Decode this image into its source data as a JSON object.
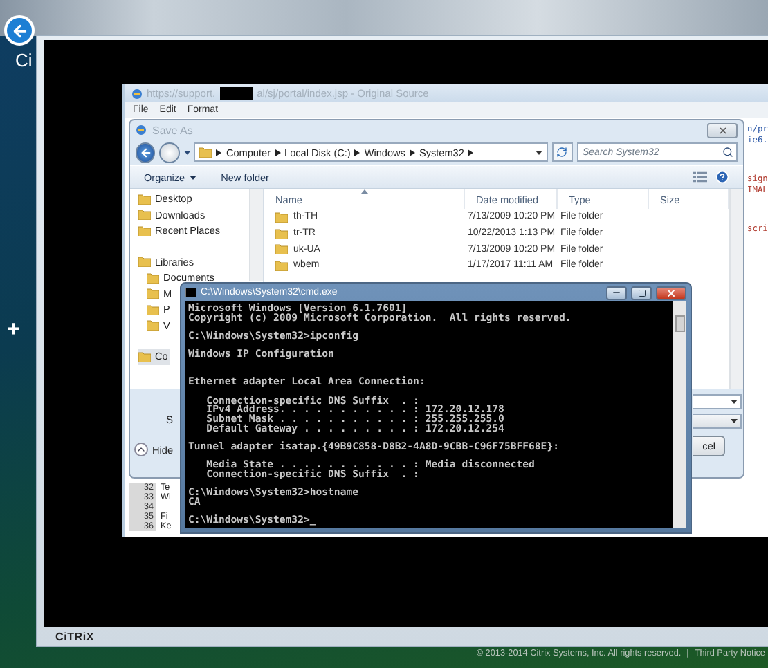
{
  "desktop": {
    "side_label": "Ci",
    "add_button": "+"
  },
  "source_window": {
    "title_start": "https://support.",
    "title_end": "al/sj/portal/index.jsp - Original Source",
    "menu": [
      "File",
      "Edit",
      "Format"
    ],
    "code_blocks": [
      [
        {
          "text": "n/pr",
          "color": "#2e5aa8"
        },
        {
          "text": "ie6.",
          "color": "#2e5aa8"
        }
      ],
      [
        {
          "text": "sign",
          "color": "#b03a2e"
        },
        {
          "text": "IMAL",
          "color": "#b03a2e"
        }
      ],
      [
        {
          "text": "scri",
          "color": "#b03a2e"
        }
      ]
    ],
    "gutter_lines": [
      {
        "number": "32",
        "text": "Te"
      },
      {
        "number": "33",
        "text": "Wi"
      },
      {
        "number": "34"
      },
      {
        "number": "35",
        "text": "Fi"
      },
      {
        "number": "36",
        "text": "Ke"
      }
    ]
  },
  "save_dialog": {
    "title": "Save As",
    "path": [
      "Computer",
      "Local Disk (C:)",
      "Windows",
      "System32"
    ],
    "search": {
      "placeholder": "Search System32"
    },
    "toolbar": [
      {
        "label": "Organize",
        "menu": true
      },
      {
        "label": "New folder",
        "menu": false
      }
    ],
    "nav_groups": [
      [
        {
          "label": "Desktop",
          "selected": false
        },
        {
          "label": "Downloads",
          "selected": false
        },
        {
          "label": "Recent Places",
          "selected": false
        }
      ],
      [
        {
          "label": "Libraries",
          "selected": false,
          "children": [
            {
              "label": "Documents",
              "selected": false
            },
            {
              "label": "M",
              "selected": false
            },
            {
              "label": "P",
              "selected": false
            },
            {
              "label": "V",
              "selected": false
            }
          ]
        }
      ],
      [
        {
          "label": "Co",
          "selected": true
        }
      ]
    ],
    "columns": [
      "Name",
      "Date modified",
      "Type",
      "Size"
    ],
    "rows": [
      {
        "name": "th-TH",
        "date": "7/13/2009 10:20 PM",
        "type": "File folder"
      },
      {
        "name": "tr-TR",
        "date": "10/22/2013 1:13 PM",
        "type": "File folder"
      },
      {
        "name": "uk-UA",
        "date": "7/13/2009 10:20 PM",
        "type": "File folder"
      },
      {
        "name": "wbem",
        "date": "1/17/2017 11:11 AM",
        "type": "File folder"
      }
    ],
    "save_type_label": "S",
    "hide_button": "Hide",
    "cancel_button": "cel"
  },
  "cmd": {
    "title": "C:\\Windows\\System32\\cmd.exe",
    "output": "Microsoft Windows [Version 6.1.7601]\nCopyright (c) 2009 Microsoft Corporation.  All rights reserved.\n\nC:\\Windows\\System32>ipconfig\n\nWindows IP Configuration\n\n\nEthernet adapter Local Area Connection:\n\n   Connection-specific DNS Suffix  . :\n   IPv4 Address. . . . . . . . . . . : 172.20.12.178\n   Subnet Mask . . . . . . . . . . . : 255.255.255.0\n   Default Gateway . . . . . . . . . : 172.20.12.254\n\nTunnel adapter isatap.{49B9C858-D8B2-4A8D-9CBB-C96F75BFF68E}:\n\n   Media State . . . . . . . . . . . : Media disconnected\n   Connection-specific DNS Suffix  . :\n\nC:\\Windows\\System32>hostname\nCA\n\nC:\\Windows\\System32>_"
  },
  "footer": {
    "logo": "CiTRiX",
    "copyright": "© 2013-2014 Citrix Systems, Inc. All rights reserved.",
    "separator": "|",
    "link": "Third Party Notice"
  }
}
